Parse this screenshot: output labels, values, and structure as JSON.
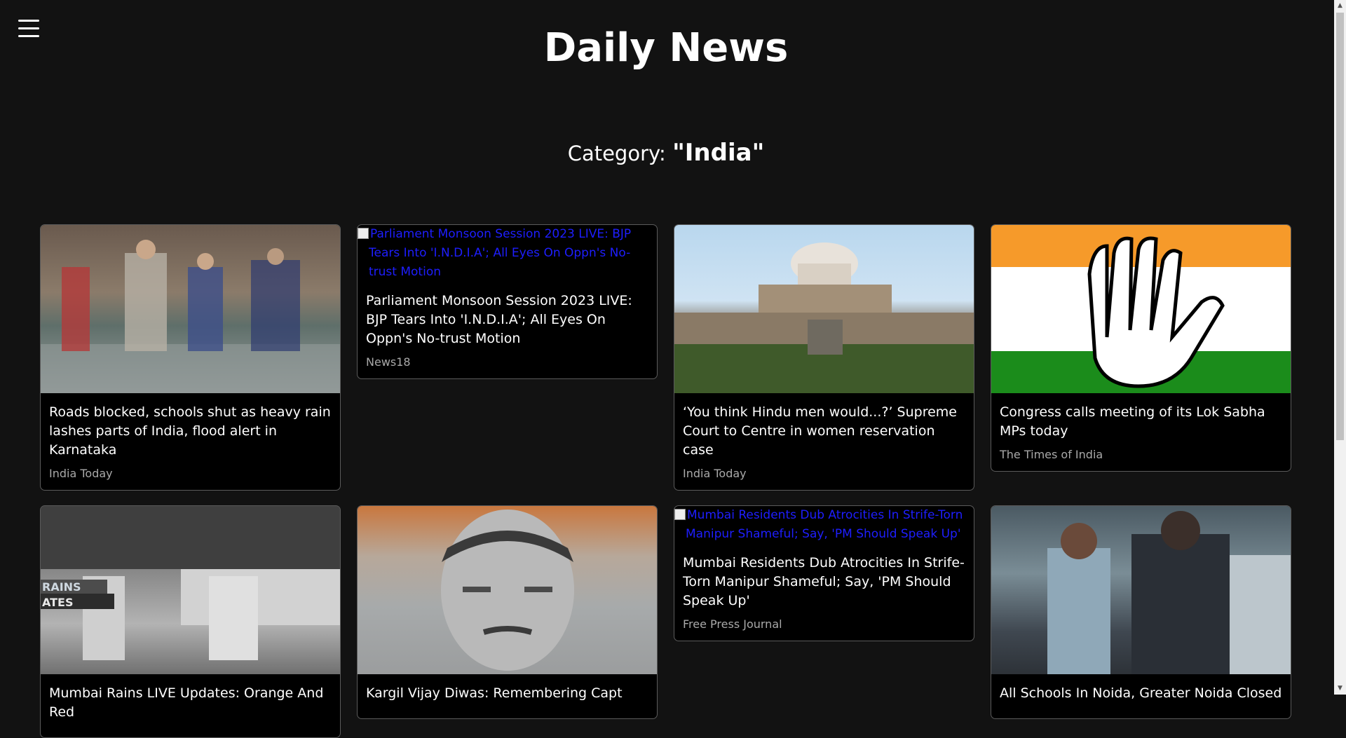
{
  "header": {
    "title": "Daily News",
    "menu_icon": "hamburger-icon"
  },
  "category": {
    "prefix": "Category:",
    "name": "\"India\""
  },
  "articles": [
    {
      "title": "Roads blocked, schools shut as heavy rain lashes parts of India, flood alert in Karnataka",
      "source": "India Today",
      "image": "rain-flood-photo"
    },
    {
      "title": "Parliament Monsoon Session 2023 LIVE: BJP Tears Into 'I.N.D.I.A'; All Eyes On Oppn's No-trust Motion",
      "source": "News18",
      "image_alt": "Parliament Monsoon Session 2023 LIVE: BJP Tears Into 'I.N.D.I.A'; All Eyes On Oppn's No-trust Motion"
    },
    {
      "title": "‘You think Hindu men would...?’ Supreme Court to Centre in women reservation case",
      "source": "India Today",
      "image": "supreme-court-photo"
    },
    {
      "title": "Congress calls meeting of its Lok Sabha MPs today",
      "source": "The Times of India",
      "image": "congress-hand-flag-logo"
    },
    {
      "title": "Mumbai Rains LIVE Updates: Orange And Red",
      "image": "mumbai-rains-photo",
      "image_text": "RAINS / ATES"
    },
    {
      "title": "Kargil Vijay Diwas: Remembering Capt",
      "image": "soldier-portrait"
    },
    {
      "title": "Mumbai Residents Dub Atrocities In Strife-Torn Manipur Shameful; Say, 'PM Should Speak Up'",
      "source": "Free Press Journal",
      "image_alt": "Mumbai Residents Dub Atrocities In Strife-Torn Manipur Shameful; Say, 'PM Should Speak Up'"
    },
    {
      "title": "All Schools In Noida, Greater Noida Closed",
      "image": "students-photo"
    }
  ],
  "colors": {
    "background": "#121212",
    "card_background": "#000000",
    "card_border": "#5b5b5b",
    "source_text": "#a9a9a9",
    "broken_link": "#1e1eff"
  }
}
